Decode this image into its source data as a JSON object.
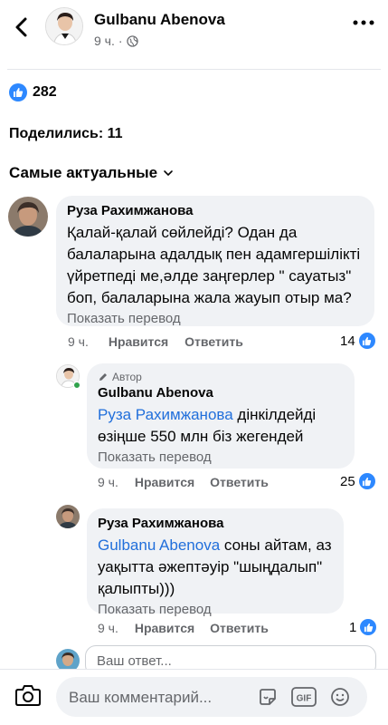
{
  "post": {
    "author": "Gulbanu Abenova",
    "time": "9 ч.",
    "likes_count": "282",
    "shares": "Поделились: 11"
  },
  "comments_sort": "Самые актуальные",
  "comments": [
    {
      "name": "Руза Рахимжанова",
      "text": "Қалай-қалай сөйлейді? Одан да балаларына адалдық пен адамгершілікті үйретпеді ме,әлде заңгерлер \" сауатыз\" боп,  балаларына жала жауып отыр ма?",
      "translate": "Показать перевод",
      "time": "9 ч.",
      "like_label": "Нравится",
      "reply_label": "Ответить",
      "reactions": "14"
    },
    {
      "author_badge": "Автор",
      "name": "Gulbanu Abenova",
      "mention": "Руза Рахимжанова",
      "text": " дінкілдейді өзіңше 550 млн біз жегендей",
      "translate": "Показать перевод",
      "time": "9 ч.",
      "like_label": "Нравится",
      "reply_label": "Ответить",
      "reactions": "25"
    },
    {
      "name": "Руза Рахимжанова",
      "mention": "Gulbanu Abenova",
      "text": " соны айтам, аз уақытта әжептәуір \"шыңдалып\" қалыпты)))",
      "translate": "Показать перевод",
      "time": "9 ч.",
      "like_label": "Нравится",
      "reply_label": "Ответить",
      "reactions": "1"
    }
  ],
  "reply_placeholder": "Ваш ответ...",
  "composer_placeholder": "Ваш комментарий...",
  "colors": {
    "accent": "#2d88ff",
    "link": "#216fdb",
    "bubble": "#f0f2f5",
    "muted": "#65676b"
  },
  "icons": [
    "back-icon",
    "globe-icon",
    "more-icon",
    "like-icon",
    "chevron-down-icon",
    "pencil-icon",
    "camera-icon",
    "sticker-icon",
    "gif-icon",
    "emoji-icon"
  ]
}
